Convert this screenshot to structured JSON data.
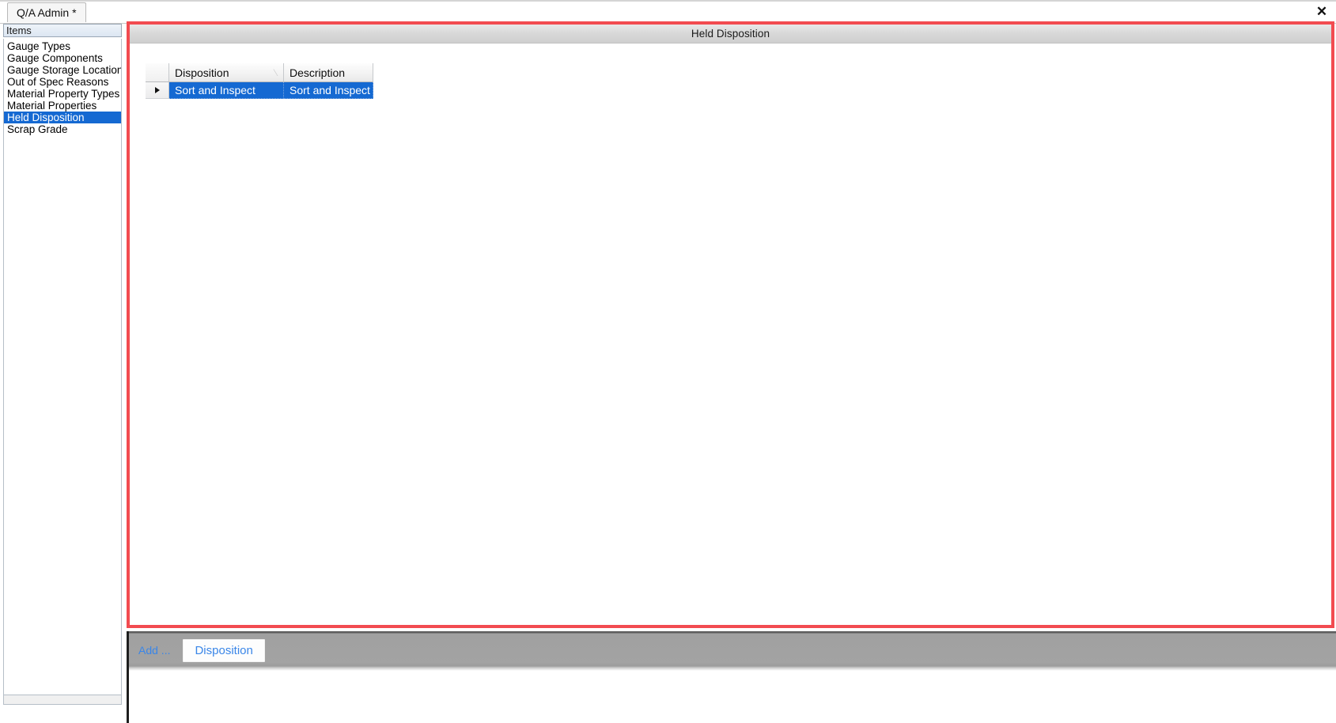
{
  "window": {
    "close_icon": "close-icon",
    "close_glyph": "✕"
  },
  "tabs": [
    {
      "label": "Q/A Admin",
      "dirty_marker": "*",
      "active": true
    }
  ],
  "sidebar": {
    "header": "Items",
    "items": [
      {
        "label": "Gauge Types",
        "selected": false
      },
      {
        "label": "Gauge Components",
        "selected": false
      },
      {
        "label": "Gauge Storage Locations",
        "selected": false
      },
      {
        "label": "Out of Spec Reasons",
        "selected": false
      },
      {
        "label": "Material Property Types",
        "selected": false
      },
      {
        "label": "Material Properties",
        "selected": false
      },
      {
        "label": "Held Disposition",
        "selected": true
      },
      {
        "label": "Scrap Grade",
        "selected": false
      }
    ]
  },
  "main": {
    "title": "Held Disposition",
    "grid": {
      "columns": [
        {
          "label": "Disposition",
          "sort": "ascending",
          "sort_glyph": "⁄"
        },
        {
          "label": "Description",
          "sort": "none",
          "sort_glyph": ""
        }
      ],
      "rows": [
        {
          "selected": true,
          "indicator": "▶",
          "disposition": "Sort and Inspect",
          "description": "Sort and Inspect"
        }
      ]
    }
  },
  "toolbar": {
    "add_label": "Add ...",
    "add_button_label": "Disposition"
  },
  "colors": {
    "selection_blue": "#1569d2",
    "panel_border_red": "#f24b50",
    "link_blue": "#3a86e8",
    "toolbar_gray": "#a3a3a3"
  }
}
